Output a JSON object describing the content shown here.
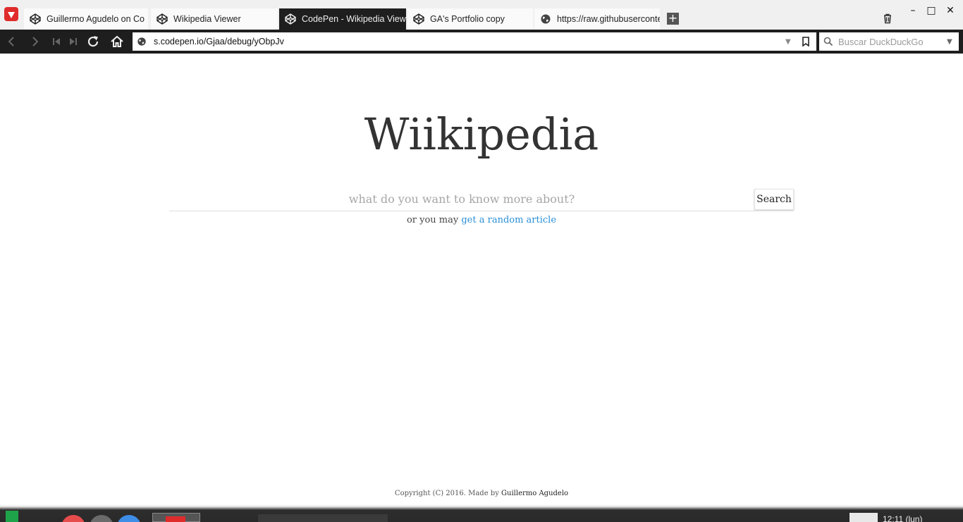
{
  "browser": {
    "tabs": [
      {
        "title": "Guillermo Agudelo on Co",
        "icon": "codepen-icon",
        "active": false
      },
      {
        "title": "Wikipedia Viewer",
        "icon": "codepen-icon",
        "active": false
      },
      {
        "title": "CodePen - Wikipedia View",
        "icon": "codepen-icon",
        "active": true
      },
      {
        "title": "GA's Portfolio copy",
        "icon": "codepen-icon",
        "active": false
      },
      {
        "title": "https://raw.githubuserconte",
        "icon": "globe-icon",
        "active": false
      }
    ],
    "new_tab_label": "+",
    "window_controls": {
      "minimize": "–",
      "maximize": "□",
      "close": "✕"
    },
    "address_bar": {
      "url": "s.codepen.io/Gjaa/debug/yObpJv"
    },
    "search_bar": {
      "placeholder": "Buscar DuckDuckGo"
    }
  },
  "page": {
    "title": "Wiikipedia",
    "search": {
      "placeholder": "what do you want to know more about?",
      "button_label": "Search"
    },
    "random": {
      "prefix": "or you may",
      "link_label": "get a random article"
    },
    "footer": {
      "prefix": "Copyright (C) 2016. Made by",
      "author": "Guillermo Agudelo"
    }
  },
  "taskbar": {
    "clock": "12:11 (lun)"
  },
  "colors": {
    "link": "#2a8fd8",
    "active_tab": "#1e1e1e",
    "brand": "#e02b2b"
  }
}
